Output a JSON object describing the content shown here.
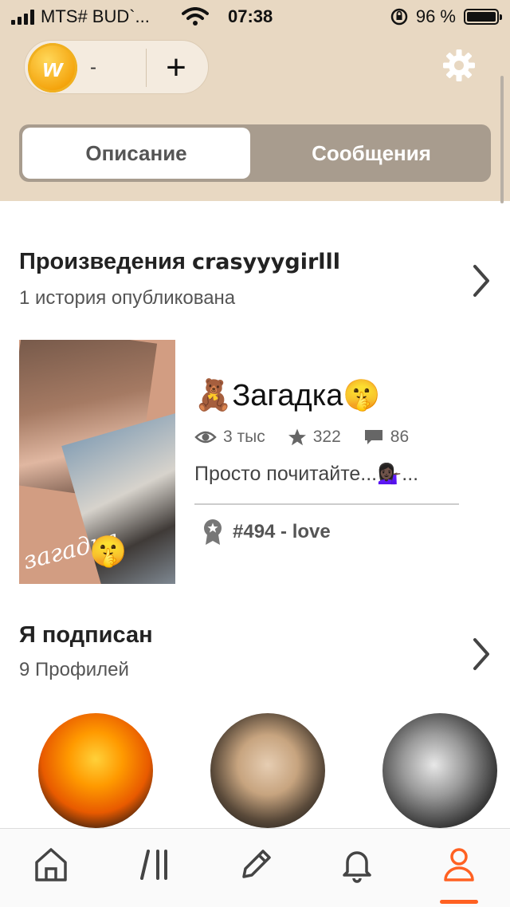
{
  "status_bar": {
    "carrier": "MTS# BUD`...",
    "time": "07:38",
    "battery_percent": "96 %"
  },
  "header": {
    "coin_count": "-",
    "add_coins_label": "+",
    "tabs": [
      {
        "label": "Описание",
        "active": true
      },
      {
        "label": "Сообщения",
        "active": false
      }
    ]
  },
  "works": {
    "title_prefix": "Произведения",
    "username": "crasyyygirlll",
    "subtitle": "1 история опубликована",
    "story": {
      "title": "🧸Загадка🤫",
      "cover_text": "загадка",
      "cover_emoji": "🤫",
      "reads": "3 тыс",
      "votes": "322",
      "comments": "86",
      "description": "Просто почитайте...💁🏿‍♀️...",
      "tag_rank": "#494 - love"
    }
  },
  "following": {
    "title": "Я подписан",
    "subtitle": "9 Профилей"
  },
  "bottom_nav": {
    "items": [
      "home",
      "library",
      "write",
      "notifications",
      "profile"
    ],
    "active": "profile"
  },
  "colors": {
    "header_bg": "#e8d8c2",
    "tab_track": "#a89c8e",
    "accent": "#ff6122"
  }
}
